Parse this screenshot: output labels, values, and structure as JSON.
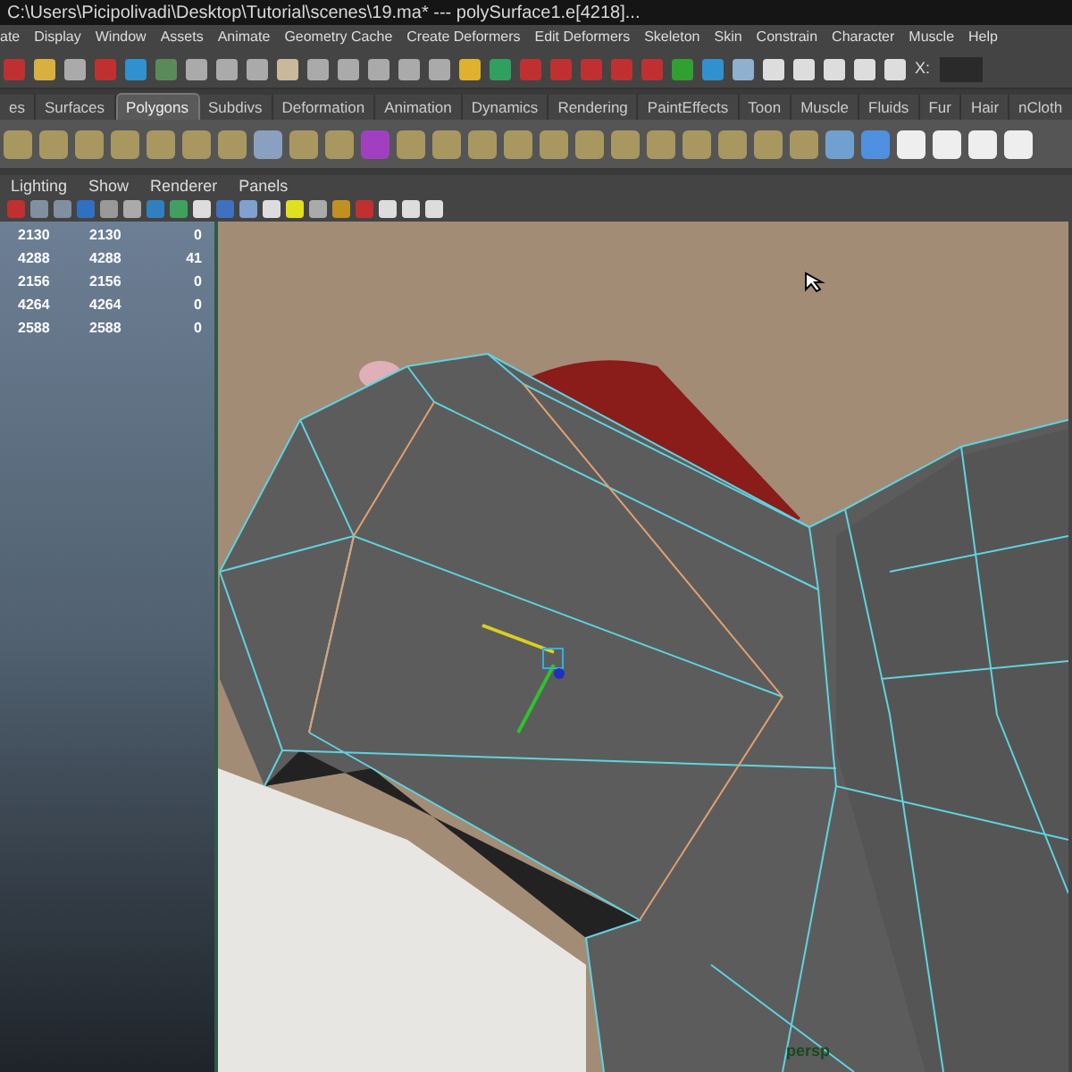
{
  "window": {
    "title": "C:\\Users\\Picipolivadi\\Desktop\\Tutorial\\scenes\\19.ma*   ---   polySurface1.e[4218]..."
  },
  "menu_bar": [
    "ate",
    "Display",
    "Window",
    "Assets",
    "Animate",
    "Geometry Cache",
    "Create Deformers",
    "Edit Deformers",
    "Skeleton",
    "Skin",
    "Constrain",
    "Character",
    "Muscle",
    "Help"
  ],
  "status_line": {
    "x_label": "X:"
  },
  "shelf_tabs": [
    {
      "label": "es",
      "selected": false
    },
    {
      "label": "Surfaces",
      "selected": false
    },
    {
      "label": "Polygons",
      "selected": true
    },
    {
      "label": "Subdivs",
      "selected": false
    },
    {
      "label": "Deformation",
      "selected": false
    },
    {
      "label": "Animation",
      "selected": false
    },
    {
      "label": "Dynamics",
      "selected": false
    },
    {
      "label": "Rendering",
      "selected": false
    },
    {
      "label": "PaintEffects",
      "selected": false
    },
    {
      "label": "Toon",
      "selected": false
    },
    {
      "label": "Muscle",
      "selected": false
    },
    {
      "label": "Fluids",
      "selected": false
    },
    {
      "label": "Fur",
      "selected": false
    },
    {
      "label": "Hair",
      "selected": false
    },
    {
      "label": "nCloth",
      "selected": false
    }
  ],
  "viewport": {
    "menu": [
      "Lighting",
      "Show",
      "Renderer",
      "Panels"
    ],
    "camera_label": "persp"
  },
  "stats_rows": [
    [
      "2130",
      "2130",
      "0"
    ],
    [
      "4288",
      "4288",
      "41"
    ],
    [
      "2156",
      "2156",
      "0"
    ],
    [
      "4264",
      "4264",
      "0"
    ],
    [
      "2588",
      "2588",
      "0"
    ]
  ]
}
